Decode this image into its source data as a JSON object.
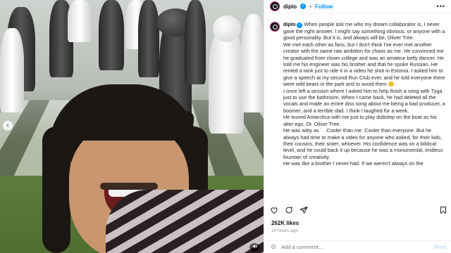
{
  "header": {
    "username": "diplo",
    "separator": "•",
    "follow_label": "Follow",
    "more_label": "•••"
  },
  "caption": {
    "username": "diplo",
    "paragraphs": [
      "When people ask me who my dream collaborator is, I never gave the right answer. I might say something obvious, or anyone with a good personality. But it is, and always will be, Oliver Tree.",
      "We met each other as fans, but I don't think I've ever met another creator with the same raw ambition for chaos as me. He convinced me he graduated from clown college and was an amateur belly dancer. He told me his engineer was his brother and that he spoke Russian. He rented a tank just to ride it in a video he shot in Estonia. I asked him to give a speech at my second Run Club ever, and he told everyone there were wild bears in the park and to avoid them 🙃.",
      "I once left a session where I asked him to help finish a song with Tyga just to use the bathroom. When I came back, he had deleted all the vocals and made an entire diss song about me being a bad producer, a boomer, and a terrible dad. I think I laughed for a week.",
      "He toured Antarctica with me just to play dubstep on the boat as his alter ego, Dr. Oliver Tree.",
      "He was witty as ´ . Cooler than me. Cooler than everyone. But he always had time to make a video for anyone who asked, for their kids, their cousins, their sister, whoever. His confidence was on a biblical level, and he could back it up because he was a monumental, endless fountain of creativity.",
      "He was like a brother I never had. If we weren't always on the"
    ]
  },
  "stats": {
    "likes": "262K likes",
    "time": "10 hours ago"
  },
  "comment": {
    "placeholder": "Add a comment...",
    "post_label": "Post",
    "emoji_icon": "☺"
  },
  "media": {
    "prev_icon": "‹",
    "mute_icon": "🔇"
  },
  "icons": [
    "heart-icon",
    "comment-icon",
    "share-icon",
    "bookmark-icon"
  ],
  "colors": {
    "accent": "#0095f6",
    "verified": "#0095f6"
  }
}
